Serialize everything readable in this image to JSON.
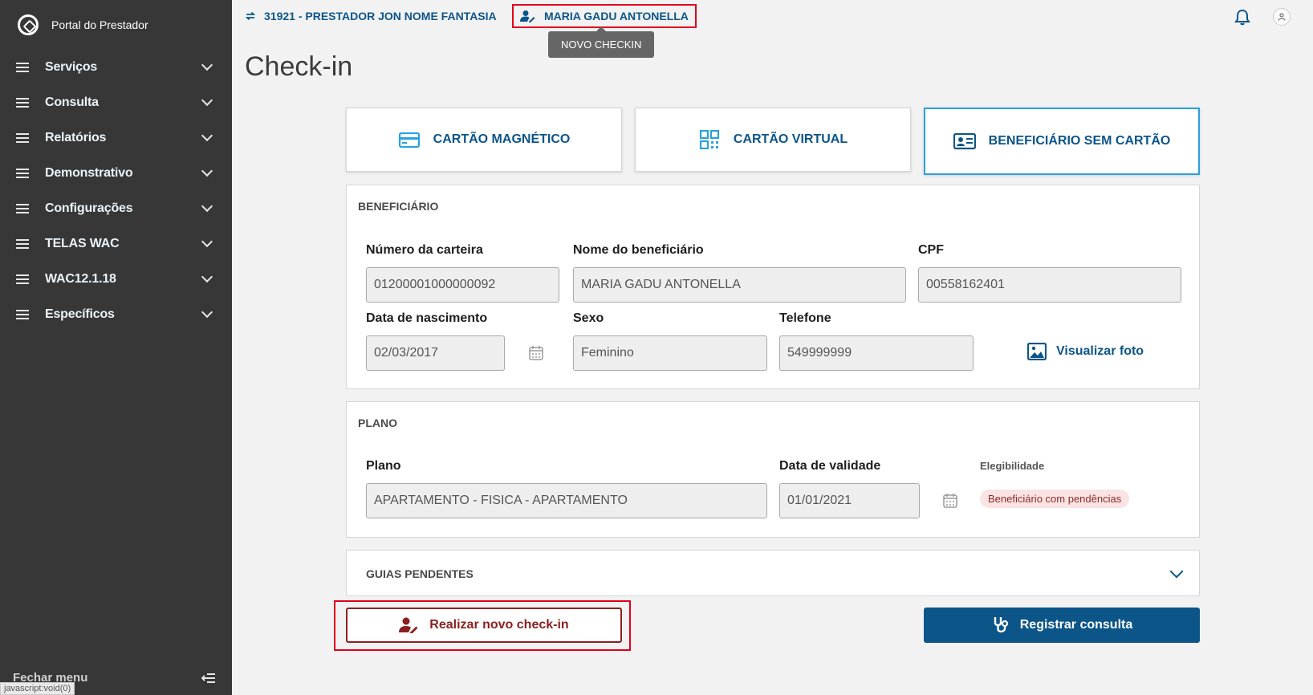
{
  "sidebar": {
    "brand": "Portal do Prestador",
    "items": [
      {
        "label": "Serviços"
      },
      {
        "label": "Consulta"
      },
      {
        "label": "Relatórios"
      },
      {
        "label": "Demonstrativo"
      },
      {
        "label": "Configurações"
      },
      {
        "label": "TELAS WAC"
      },
      {
        "label": "WAC12.1.18"
      },
      {
        "label": "Específicos"
      }
    ],
    "close_label": "Fechar menu",
    "status_url": "javascript:void(0)"
  },
  "topbar": {
    "prestador": "31921 - PRESTADOR JON NOME FANTASIA",
    "beneficiario": "MARIA GADU ANTONELLA",
    "tooltip": "NOVO CHECKIN"
  },
  "page": {
    "title": "Check-in"
  },
  "tabs": [
    {
      "label": "CARTÃO MAGNÉTICO",
      "icon": "credit-card-icon"
    },
    {
      "label": "CARTÃO VIRTUAL",
      "icon": "qr-code-icon"
    },
    {
      "label": "BENEFICIÁRIO SEM CARTÃO",
      "icon": "id-card-icon",
      "active": true
    }
  ],
  "beneficiario_section": {
    "title": "BENEFICIÁRIO",
    "numero_carteira": {
      "label": "Número da carteira",
      "value": "01200001000000092"
    },
    "nome": {
      "label": "Nome do beneficiário",
      "value": "MARIA GADU ANTONELLA"
    },
    "cpf": {
      "label": "CPF",
      "value": "00558162401"
    },
    "nascimento": {
      "label": "Data de nascimento",
      "value": "02/03/2017"
    },
    "sexo": {
      "label": "Sexo",
      "value": "Feminino"
    },
    "telefone": {
      "label": "Telefone",
      "value": "549999999"
    },
    "foto_link": "Visualizar foto"
  },
  "plano_section": {
    "title": "PLANO",
    "plano": {
      "label": "Plano",
      "value": "APARTAMENTO - FISICA - APARTAMENTO"
    },
    "validade": {
      "label": "Data de validade",
      "value": "01/01/2021"
    },
    "elegibilidade": {
      "label": "Elegibilidade",
      "value": "Beneficiário com pendências"
    }
  },
  "guias": {
    "title": "GUIAS PENDENTES"
  },
  "actions": {
    "novo_checkin": "Realizar novo check-in",
    "registrar": "Registrar consulta"
  },
  "colors": {
    "primary": "#0c5589",
    "sidebar_bg": "#373737",
    "active_tab_border": "#29a1e0",
    "highlight_red": "#e2001a",
    "danger_text": "#8b1f1f"
  }
}
